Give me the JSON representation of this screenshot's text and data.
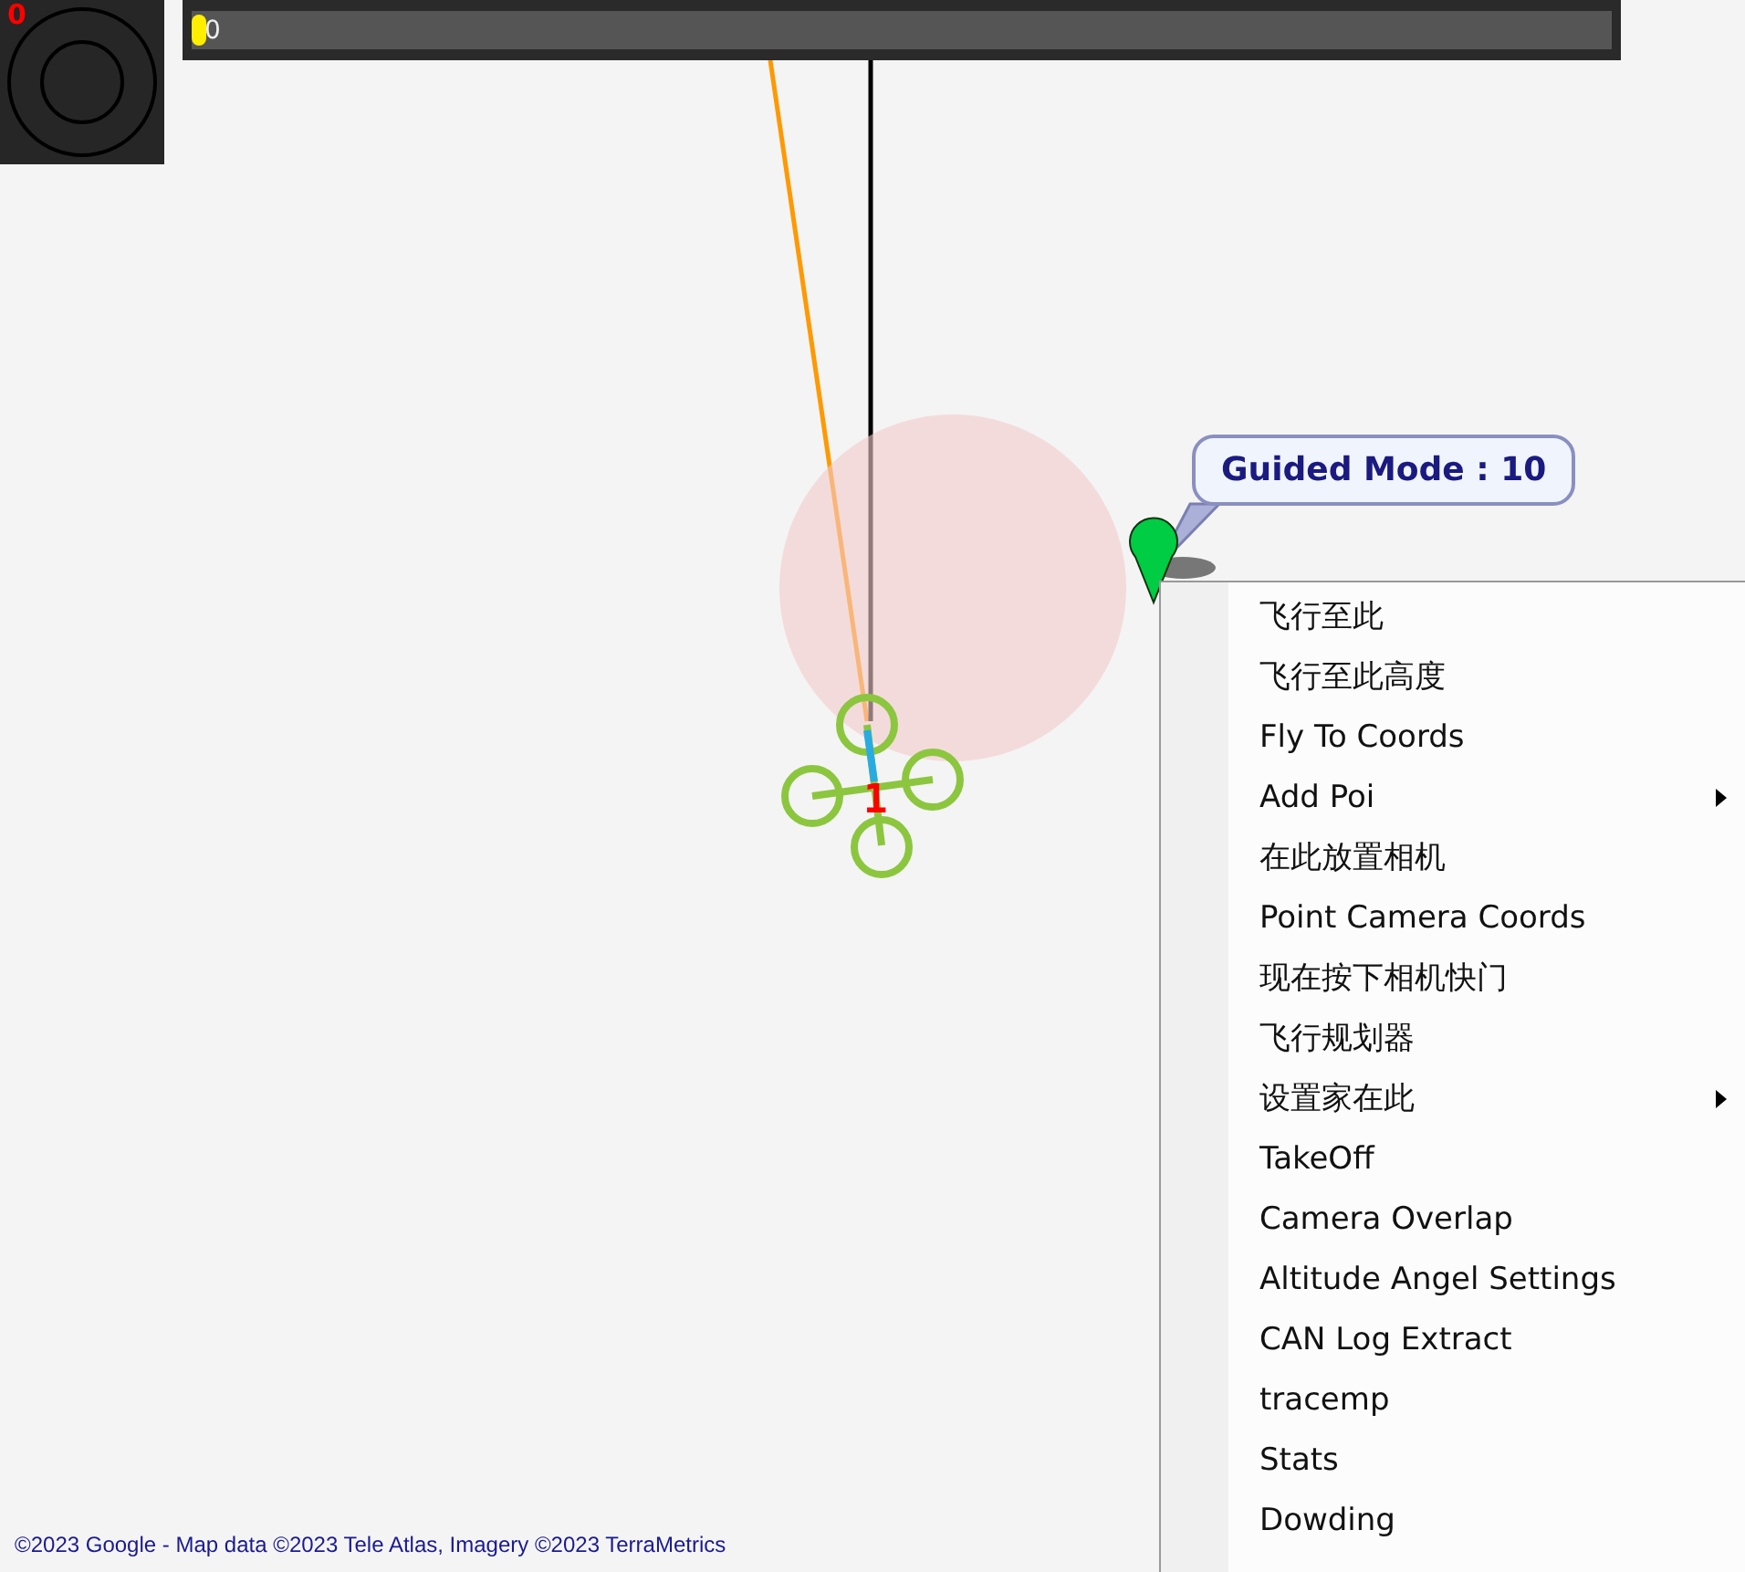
{
  "hud": {
    "value": "0"
  },
  "heading_bar": {
    "value": "0"
  },
  "callout": {
    "text": "Guided Mode : 10"
  },
  "vehicle": {
    "label": "1"
  },
  "context_menu": {
    "items": [
      {
        "label": "飞行至此",
        "has_submenu": false
      },
      {
        "label": "飞行至此高度",
        "has_submenu": false
      },
      {
        "label": "Fly To Coords",
        "has_submenu": false
      },
      {
        "label": "Add Poi",
        "has_submenu": true
      },
      {
        "label": "在此放置相机",
        "has_submenu": false
      },
      {
        "label": "Point Camera Coords",
        "has_submenu": false
      },
      {
        "label": "现在按下相机快门",
        "has_submenu": false
      },
      {
        "label": "飞行规划器",
        "has_submenu": false
      },
      {
        "label": "设置家在此",
        "has_submenu": true
      },
      {
        "label": "TakeOff",
        "has_submenu": false
      },
      {
        "label": "Camera Overlap",
        "has_submenu": false
      },
      {
        "label": "Altitude Angel Settings",
        "has_submenu": false
      },
      {
        "label": "CAN Log Extract",
        "has_submenu": false
      },
      {
        "label": "tracemp",
        "has_submenu": false
      },
      {
        "label": "Stats",
        "has_submenu": false
      },
      {
        "label": "Dowding",
        "has_submenu": false
      }
    ]
  },
  "attribution": "©2023 Google - Map data ©2023 Tele Atlas, Imagery ©2023 TerraMetrics"
}
